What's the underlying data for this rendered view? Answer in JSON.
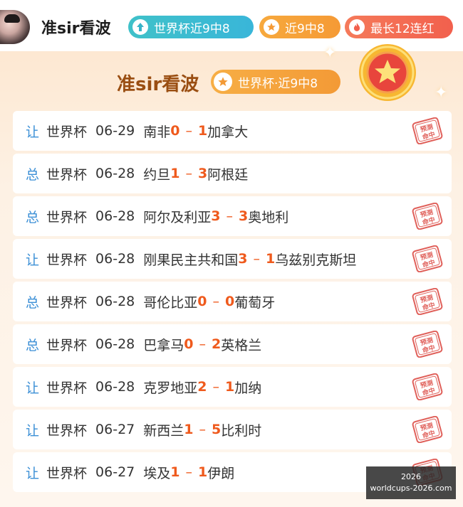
{
  "header": {
    "username": "准sir看波",
    "badges": [
      {
        "label": "世界杯近9中8",
        "icon": "arrow-up-icon"
      },
      {
        "label": "近9中8",
        "icon": "star-icon"
      },
      {
        "label": "最长12连红",
        "icon": "flame-icon"
      }
    ]
  },
  "panel": {
    "title": "准sir看波",
    "title_badge": "世界杯·近9中8",
    "title_badge_icon": "star-icon"
  },
  "records": [
    {
      "kind": "让",
      "competition": "世界杯",
      "date": "06-29",
      "home": "南非",
      "home_score": "0",
      "away_score": "1",
      "away": "加拿大",
      "hit": true
    },
    {
      "kind": "总",
      "competition": "世界杯",
      "date": "06-28",
      "home": "约旦",
      "home_score": "1",
      "away_score": "3",
      "away": "阿根廷",
      "hit": false
    },
    {
      "kind": "总",
      "competition": "世界杯",
      "date": "06-28",
      "home": "阿尔及利亚",
      "home_score": "3",
      "away_score": "3",
      "away": "奥地利",
      "hit": true
    },
    {
      "kind": "让",
      "competition": "世界杯",
      "date": "06-28",
      "home": "刚果民主共和国",
      "home_score": "3",
      "away_score": "1",
      "away": "乌兹别克斯坦",
      "hit": true
    },
    {
      "kind": "总",
      "competition": "世界杯",
      "date": "06-28",
      "home": "哥伦比亚",
      "home_score": "0",
      "away_score": "0",
      "away": "葡萄牙",
      "hit": true
    },
    {
      "kind": "总",
      "competition": "世界杯",
      "date": "06-28",
      "home": "巴拿马",
      "home_score": "0",
      "away_score": "2",
      "away": "英格兰",
      "hit": true
    },
    {
      "kind": "让",
      "competition": "世界杯",
      "date": "06-28",
      "home": "克罗地亚",
      "home_score": "2",
      "away_score": "1",
      "away": "加纳",
      "hit": true
    },
    {
      "kind": "让",
      "competition": "世界杯",
      "date": "06-27",
      "home": "新西兰",
      "home_score": "1",
      "away_score": "5",
      "away": "比利时",
      "hit": true
    },
    {
      "kind": "让",
      "competition": "世界杯",
      "date": "06-27",
      "home": "埃及",
      "home_score": "1",
      "away_score": "1",
      "away": "伊朗",
      "hit": true
    }
  ],
  "stamp_text": [
    "预测",
    "命中"
  ],
  "watermark": {
    "line1": "2026",
    "line2": "worldcups-2026.com"
  },
  "colors": {
    "kind": "#3b8fd6",
    "score": "#ef5a1d",
    "stamp": "#e0605a",
    "title": "#9a4e12"
  }
}
